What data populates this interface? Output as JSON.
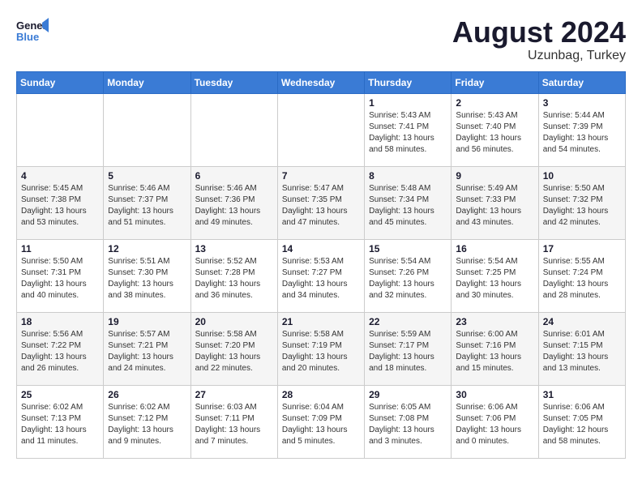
{
  "header": {
    "logo_line1": "General",
    "logo_line2": "Blue",
    "month_year": "August 2024",
    "location": "Uzunbag, Turkey"
  },
  "weekdays": [
    "Sunday",
    "Monday",
    "Tuesday",
    "Wednesday",
    "Thursday",
    "Friday",
    "Saturday"
  ],
  "weeks": [
    [
      {
        "day": "",
        "info": ""
      },
      {
        "day": "",
        "info": ""
      },
      {
        "day": "",
        "info": ""
      },
      {
        "day": "",
        "info": ""
      },
      {
        "day": "1",
        "info": "Sunrise: 5:43 AM\nSunset: 7:41 PM\nDaylight: 13 hours\nand 58 minutes."
      },
      {
        "day": "2",
        "info": "Sunrise: 5:43 AM\nSunset: 7:40 PM\nDaylight: 13 hours\nand 56 minutes."
      },
      {
        "day": "3",
        "info": "Sunrise: 5:44 AM\nSunset: 7:39 PM\nDaylight: 13 hours\nand 54 minutes."
      }
    ],
    [
      {
        "day": "4",
        "info": "Sunrise: 5:45 AM\nSunset: 7:38 PM\nDaylight: 13 hours\nand 53 minutes."
      },
      {
        "day": "5",
        "info": "Sunrise: 5:46 AM\nSunset: 7:37 PM\nDaylight: 13 hours\nand 51 minutes."
      },
      {
        "day": "6",
        "info": "Sunrise: 5:46 AM\nSunset: 7:36 PM\nDaylight: 13 hours\nand 49 minutes."
      },
      {
        "day": "7",
        "info": "Sunrise: 5:47 AM\nSunset: 7:35 PM\nDaylight: 13 hours\nand 47 minutes."
      },
      {
        "day": "8",
        "info": "Sunrise: 5:48 AM\nSunset: 7:34 PM\nDaylight: 13 hours\nand 45 minutes."
      },
      {
        "day": "9",
        "info": "Sunrise: 5:49 AM\nSunset: 7:33 PM\nDaylight: 13 hours\nand 43 minutes."
      },
      {
        "day": "10",
        "info": "Sunrise: 5:50 AM\nSunset: 7:32 PM\nDaylight: 13 hours\nand 42 minutes."
      }
    ],
    [
      {
        "day": "11",
        "info": "Sunrise: 5:50 AM\nSunset: 7:31 PM\nDaylight: 13 hours\nand 40 minutes."
      },
      {
        "day": "12",
        "info": "Sunrise: 5:51 AM\nSunset: 7:30 PM\nDaylight: 13 hours\nand 38 minutes."
      },
      {
        "day": "13",
        "info": "Sunrise: 5:52 AM\nSunset: 7:28 PM\nDaylight: 13 hours\nand 36 minutes."
      },
      {
        "day": "14",
        "info": "Sunrise: 5:53 AM\nSunset: 7:27 PM\nDaylight: 13 hours\nand 34 minutes."
      },
      {
        "day": "15",
        "info": "Sunrise: 5:54 AM\nSunset: 7:26 PM\nDaylight: 13 hours\nand 32 minutes."
      },
      {
        "day": "16",
        "info": "Sunrise: 5:54 AM\nSunset: 7:25 PM\nDaylight: 13 hours\nand 30 minutes."
      },
      {
        "day": "17",
        "info": "Sunrise: 5:55 AM\nSunset: 7:24 PM\nDaylight: 13 hours\nand 28 minutes."
      }
    ],
    [
      {
        "day": "18",
        "info": "Sunrise: 5:56 AM\nSunset: 7:22 PM\nDaylight: 13 hours\nand 26 minutes."
      },
      {
        "day": "19",
        "info": "Sunrise: 5:57 AM\nSunset: 7:21 PM\nDaylight: 13 hours\nand 24 minutes."
      },
      {
        "day": "20",
        "info": "Sunrise: 5:58 AM\nSunset: 7:20 PM\nDaylight: 13 hours\nand 22 minutes."
      },
      {
        "day": "21",
        "info": "Sunrise: 5:58 AM\nSunset: 7:19 PM\nDaylight: 13 hours\nand 20 minutes."
      },
      {
        "day": "22",
        "info": "Sunrise: 5:59 AM\nSunset: 7:17 PM\nDaylight: 13 hours\nand 18 minutes."
      },
      {
        "day": "23",
        "info": "Sunrise: 6:00 AM\nSunset: 7:16 PM\nDaylight: 13 hours\nand 15 minutes."
      },
      {
        "day": "24",
        "info": "Sunrise: 6:01 AM\nSunset: 7:15 PM\nDaylight: 13 hours\nand 13 minutes."
      }
    ],
    [
      {
        "day": "25",
        "info": "Sunrise: 6:02 AM\nSunset: 7:13 PM\nDaylight: 13 hours\nand 11 minutes."
      },
      {
        "day": "26",
        "info": "Sunrise: 6:02 AM\nSunset: 7:12 PM\nDaylight: 13 hours\nand 9 minutes."
      },
      {
        "day": "27",
        "info": "Sunrise: 6:03 AM\nSunset: 7:11 PM\nDaylight: 13 hours\nand 7 minutes."
      },
      {
        "day": "28",
        "info": "Sunrise: 6:04 AM\nSunset: 7:09 PM\nDaylight: 13 hours\nand 5 minutes."
      },
      {
        "day": "29",
        "info": "Sunrise: 6:05 AM\nSunset: 7:08 PM\nDaylight: 13 hours\nand 3 minutes."
      },
      {
        "day": "30",
        "info": "Sunrise: 6:06 AM\nSunset: 7:06 PM\nDaylight: 13 hours\nand 0 minutes."
      },
      {
        "day": "31",
        "info": "Sunrise: 6:06 AM\nSunset: 7:05 PM\nDaylight: 12 hours\nand 58 minutes."
      }
    ]
  ]
}
